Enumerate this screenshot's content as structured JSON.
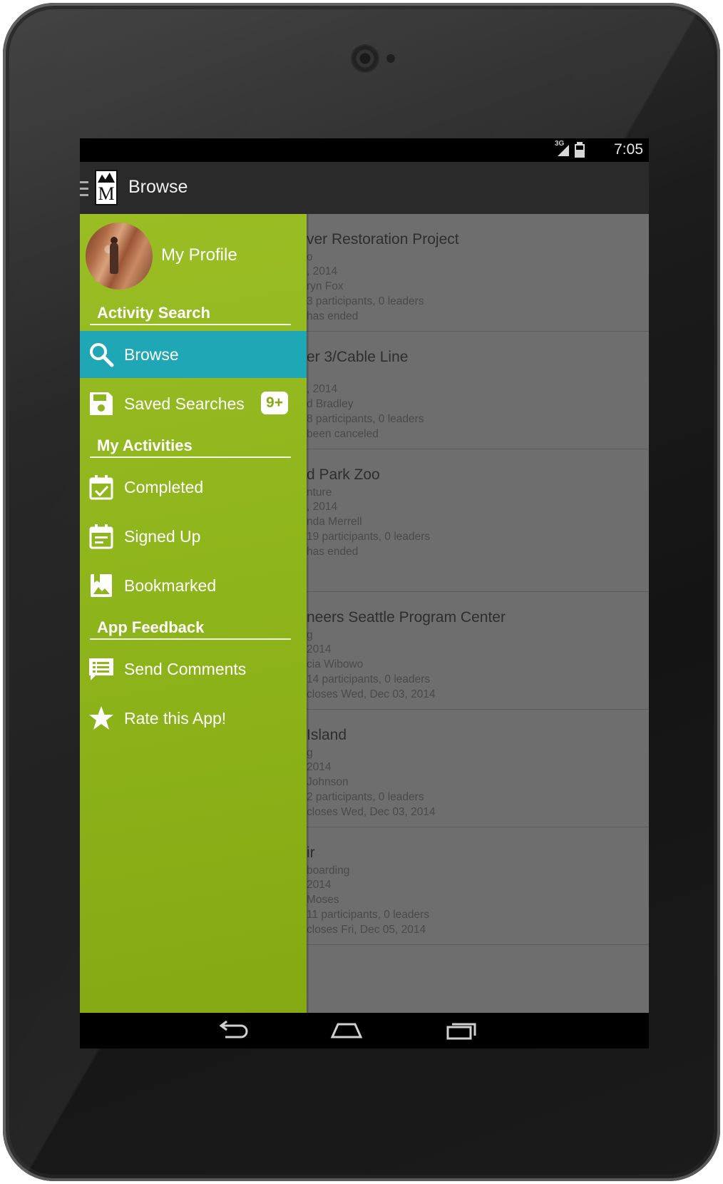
{
  "status_bar": {
    "network_label": "3G",
    "time": "7:05",
    "icons": [
      "signal-icon",
      "battery-icon"
    ]
  },
  "action_bar": {
    "logo_letter": "M",
    "title": "Browse",
    "icons": [
      "menu-icon",
      "app-logo"
    ]
  },
  "drawer": {
    "profile_label": "My Profile",
    "sections": {
      "activity_search": "Activity Search",
      "my_activities": "My Activities",
      "app_feedback": "App Feedback"
    },
    "items": {
      "browse": "Browse",
      "saved_searches": "Saved Searches",
      "saved_searches_badge": "9+",
      "completed": "Completed",
      "signed_up": "Signed Up",
      "bookmarked": "Bookmarked",
      "send_comments": "Send Comments",
      "rate_app": "Rate this App!"
    },
    "active_item": "Browse",
    "colors": {
      "background": "#8fb51c",
      "active": "#20a7b5"
    },
    "icons": [
      "search-icon",
      "save-icon",
      "calendar-check-icon",
      "calendar-list-icon",
      "bookmark-image-icon",
      "comment-list-icon",
      "star-icon"
    ]
  },
  "activity_list": [
    {
      "title": "ver Restoration Project",
      "lines": [
        "o",
        ", 2014",
        "ryn Fox",
        "3 participants, 0 leaders",
        "has ended"
      ]
    },
    {
      "title": "er 3/Cable Line",
      "lines": [
        "",
        ", 2014",
        "d Bradley",
        "8 participants, 0 leaders",
        "been canceled"
      ]
    },
    {
      "title": "d Park Zoo",
      "lines": [
        "nture",
        ", 2014",
        "nda Merrell",
        "19 participants, 0 leaders",
        "has ended"
      ]
    },
    {
      "title": "neers Seattle Program Center",
      "lines": [
        "g",
        "2014",
        "cia Wibowo",
        "14 participants, 0 leaders",
        "closes Wed, Dec 03, 2014"
      ]
    },
    {
      "title": "Island",
      "lines": [
        "g",
        "2014",
        "Johnson",
        "2 participants, 0 leaders",
        "closes Wed, Dec 03, 2014"
      ]
    },
    {
      "title": "ir",
      "lines": [
        "boarding",
        "2014",
        "Moses",
        "11 participants, 0 leaders",
        "closes Fri, Dec 05, 2014"
      ]
    }
  ],
  "nav_bar": {
    "icons": [
      "back-icon",
      "home-icon",
      "recents-icon"
    ]
  }
}
